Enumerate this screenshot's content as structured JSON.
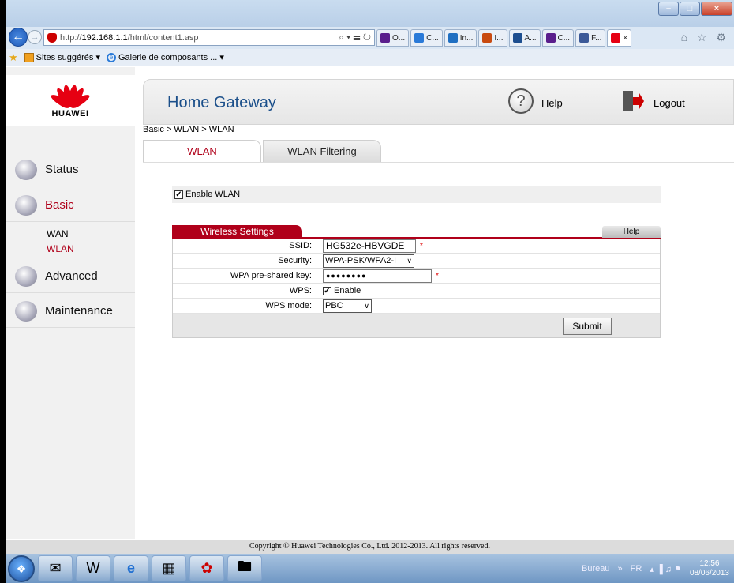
{
  "browser": {
    "url_prefix": "http://",
    "url_host": "192.168.1.1",
    "url_path": "/html/content1.asp",
    "url_tools": "⌕ ▾ ☰ ↻",
    "tabs": [
      {
        "label": "O...",
        "color": "#5a1e8c"
      },
      {
        "label": "C...",
        "color": "#2a7ad8"
      },
      {
        "label": "In...",
        "color": "#1f6fc2"
      },
      {
        "label": "I...",
        "color": "#c84a10"
      },
      {
        "label": "A...",
        "color": "#1d4e8f"
      },
      {
        "label": "C...",
        "color": "#5a1e8c"
      },
      {
        "label": "F...",
        "color": "#3b5998"
      },
      {
        "label": "×",
        "color": "#e60012"
      }
    ],
    "tool_icons": "⌂ ☆ ⚙",
    "favorites": {
      "suggested": "Sites suggérés ▾",
      "gallery": "Galerie de composants ... ▾"
    },
    "window_buttons": {
      "min": "–",
      "max": "□",
      "close": "×"
    }
  },
  "app": {
    "brand": "HUAWEI",
    "title": "Home Gateway",
    "help_label": "Help",
    "logout_label": "Logout",
    "breadcrumb": "Basic > WLAN > WLAN",
    "accent_color": "#b0001a"
  },
  "sidebar": {
    "status": "Status",
    "basic": "Basic",
    "sub_wan": "WAN",
    "sub_wlan": "WLAN",
    "advanced": "Advanced",
    "maintenance": "Maintenance"
  },
  "tabs": {
    "wlan": "WLAN",
    "filtering": "WLAN Filtering"
  },
  "enable_wlan": {
    "label": "Enable WLAN",
    "checked": true,
    "check": "✓"
  },
  "wireless": {
    "section_title": "Wireless Settings",
    "help": "Help",
    "ssid_label": "SSID:",
    "ssid_value": "HG532e-HBVGDE",
    "required": "*",
    "security_label": "Security:",
    "security_value": "WPA-PSK/WPA2-I",
    "key_label": "WPA pre-shared key:",
    "key_value": "●●●●●●●●",
    "wps_label": "WPS:",
    "wps_enable": "Enable",
    "wps_mode_label": "WPS mode:",
    "wps_mode_value": "PBC",
    "submit": "Submit",
    "arrow": "∨"
  },
  "footer": "Copyright © Huawei Technologies Co., Ltd. 2012-2013. All rights reserved.",
  "taskbar": {
    "desktop": "Bureau",
    "chevron": "»",
    "lang": "FR",
    "tray_icons": "▴ ▐ ♫ ⚑",
    "time": "12:56",
    "date": "08/06/2013"
  }
}
